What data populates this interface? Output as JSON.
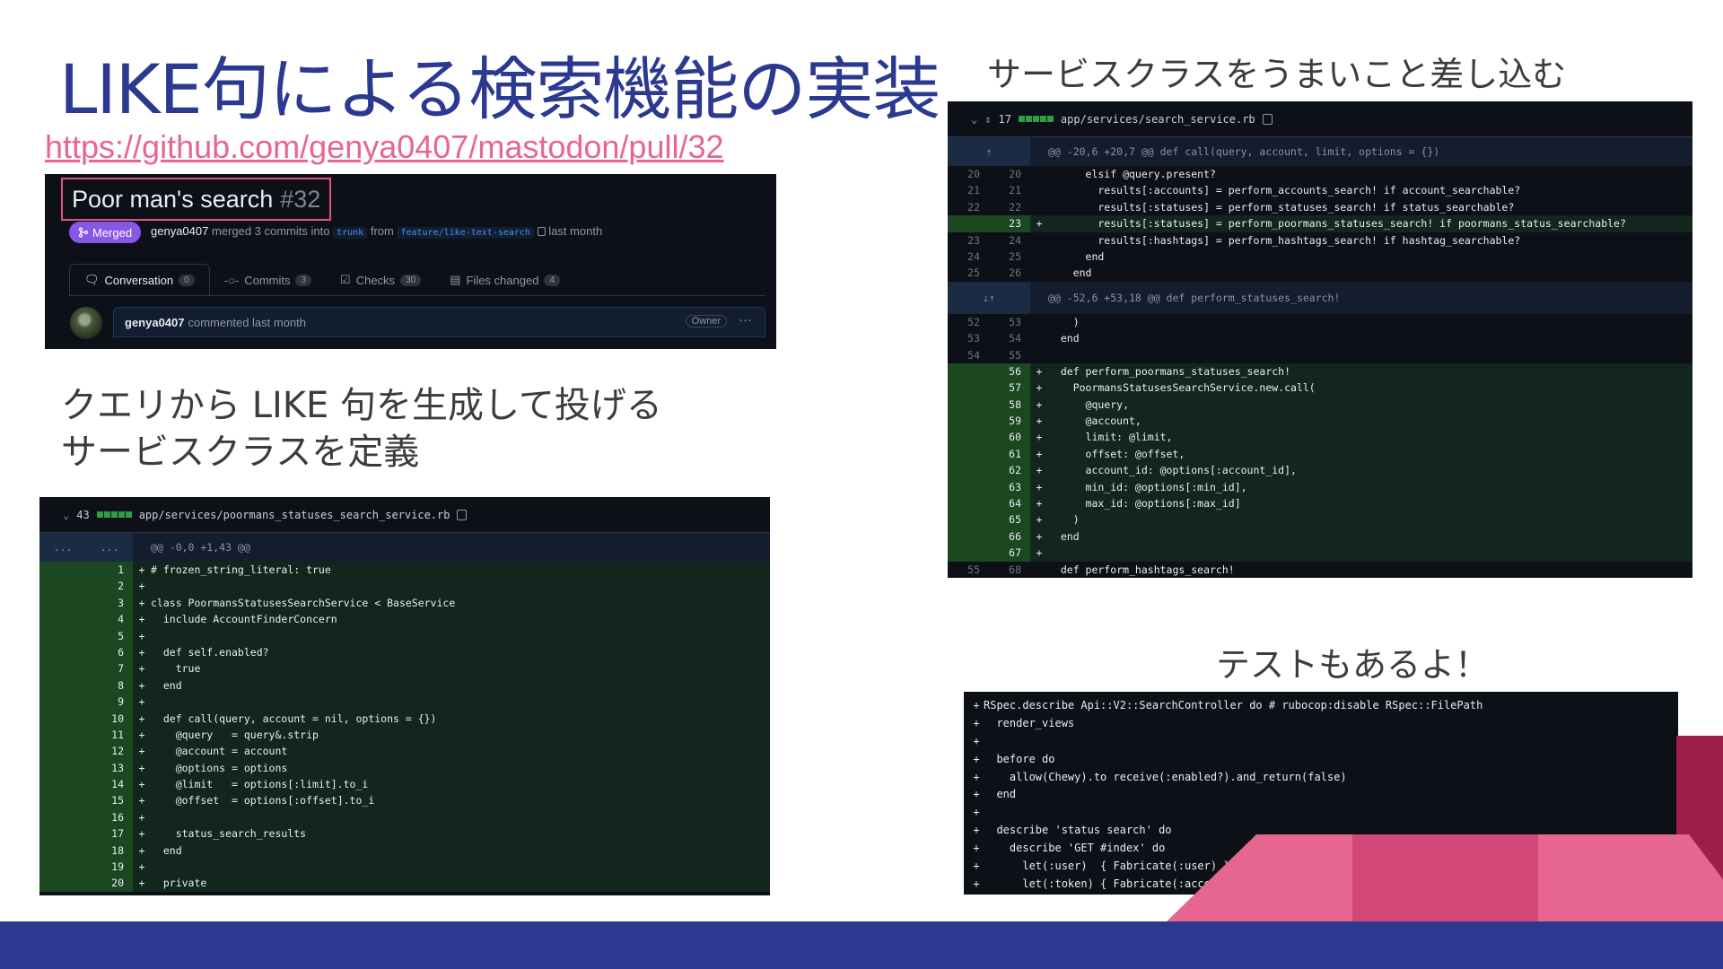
{
  "slide": {
    "title": "LIKE句による検索機能の実装",
    "link": "https://github.com/genya0407/mastodon/pull/32",
    "caption_left_1": "クエリから LIKE 句を生成して投げる",
    "caption_left_2": "サービスクラスを定義",
    "caption_right": "サービスクラスをうまいこと差し込む",
    "caption_test": "テストもあるよ！"
  },
  "colors": {
    "title": "#2b3990",
    "link": "#e7668f",
    "merged": "#8957e5",
    "added_bg": "#12261e"
  },
  "pr": {
    "title": "Poor man's search",
    "number": "#32",
    "merged_label": "Merged",
    "merged_icon": "merge-icon",
    "author": "genya0407",
    "merge_text": "merged 3 commits into",
    "base_branch": "trunk",
    "from_text": "from",
    "head_branch": "feature/like-text-search",
    "time": "last month",
    "tabs": [
      {
        "label": "Conversation",
        "count": "0",
        "icon": "comment-icon"
      },
      {
        "label": "Commits",
        "count": "3",
        "icon": "commit-icon"
      },
      {
        "label": "Checks",
        "count": "30",
        "icon": "checks-icon"
      },
      {
        "label": "Files changed",
        "count": "4",
        "icon": "file-diff-icon"
      }
    ],
    "comment_author": "genya0407",
    "comment_text": "commented last month",
    "owner_badge": "Owner",
    "kebab": "···"
  },
  "left_file": {
    "changes": "43",
    "path": "app/services/poormans_statuses_search_service.rb",
    "hunk_left": "...",
    "hunk_right": "...",
    "hunk": "@@ -0,0 +1,43 @@",
    "lines": [
      [
        "1",
        "# frozen_string_literal: true"
      ],
      [
        "2",
        ""
      ],
      [
        "3",
        "class PoormansStatusesSearchService < BaseService"
      ],
      [
        "4",
        "  include AccountFinderConcern"
      ],
      [
        "5",
        ""
      ],
      [
        "6",
        "  def self.enabled?"
      ],
      [
        "7",
        "    true"
      ],
      [
        "8",
        "  end"
      ],
      [
        "9",
        ""
      ],
      [
        "10",
        "  def call(query, account = nil, options = {})"
      ],
      [
        "11",
        "    @query   = query&.strip"
      ],
      [
        "12",
        "    @account = account"
      ],
      [
        "13",
        "    @options = options"
      ],
      [
        "14",
        "    @limit   = options[:limit].to_i"
      ],
      [
        "15",
        "    @offset  = options[:offset].to_i"
      ],
      [
        "16",
        ""
      ],
      [
        "17",
        "    status_search_results"
      ],
      [
        "18",
        "  end"
      ],
      [
        "19",
        ""
      ],
      [
        "20",
        "  private"
      ]
    ]
  },
  "right_file": {
    "changes": "17",
    "path": "app/services/search_service.rb",
    "hunk1": "@@ -20,6 +20,7 @@ def call(query, account, limit, options = {})",
    "hunk2": "@@ -52,6 +53,18 @@ def perform_statuses_search!",
    "lines_a": [
      [
        "20",
        "20",
        "",
        "      elsif @query.present?"
      ],
      [
        "21",
        "21",
        "",
        "        results[:accounts] = perform_accounts_search! if account_searchable?"
      ],
      [
        "22",
        "22",
        "",
        "        results[:statuses] = perform_statuses_search! if status_searchable?"
      ],
      [
        "",
        "23",
        "+",
        "        results[:statuses] = perform_poormans_statuses_search! if poormans_status_searchable?"
      ],
      [
        "23",
        "24",
        "",
        "        results[:hashtags] = perform_hashtags_search! if hashtag_searchable?"
      ],
      [
        "24",
        "25",
        "",
        "      end"
      ],
      [
        "25",
        "26",
        "",
        "    end"
      ]
    ],
    "lines_b": [
      [
        "52",
        "53",
        "",
        "    )"
      ],
      [
        "53",
        "54",
        "",
        "  end"
      ],
      [
        "54",
        "55",
        "",
        ""
      ],
      [
        "",
        "56",
        "+",
        "  def perform_poormans_statuses_search!"
      ],
      [
        "",
        "57",
        "+",
        "    PoormansStatusesSearchService.new.call("
      ],
      [
        "",
        "58",
        "+",
        "      @query,"
      ],
      [
        "",
        "59",
        "+",
        "      @account,"
      ],
      [
        "",
        "60",
        "+",
        "      limit: @limit,"
      ],
      [
        "",
        "61",
        "+",
        "      offset: @offset,"
      ],
      [
        "",
        "62",
        "+",
        "      account_id: @options[:account_id],"
      ],
      [
        "",
        "63",
        "+",
        "      min_id: @options[:min_id],"
      ],
      [
        "",
        "64",
        "+",
        "      max_id: @options[:max_id]"
      ],
      [
        "",
        "65",
        "+",
        "    )"
      ],
      [
        "",
        "66",
        "+",
        "  end"
      ],
      [
        "",
        "67",
        "+",
        ""
      ],
      [
        "55",
        "68",
        "",
        "  def perform_hashtags_search!"
      ]
    ]
  },
  "test_file": {
    "lines": [
      "RSpec.describe Api::V2::SearchController do # rubocop:disable RSpec::FilePath",
      "  render_views",
      "",
      "  before do",
      "    allow(Chewy).to receive(:enabled?).and_return(false)",
      "  end",
      "",
      "  describe 'status search' do",
      "    describe 'GET #index' do",
      "      let(:user)  { Fabricate(:user) }",
      "      let(:token) { Fabricate(:accessible_access_token, resource_owner_id: user.id, scopes: 'read:search') }"
    ]
  }
}
